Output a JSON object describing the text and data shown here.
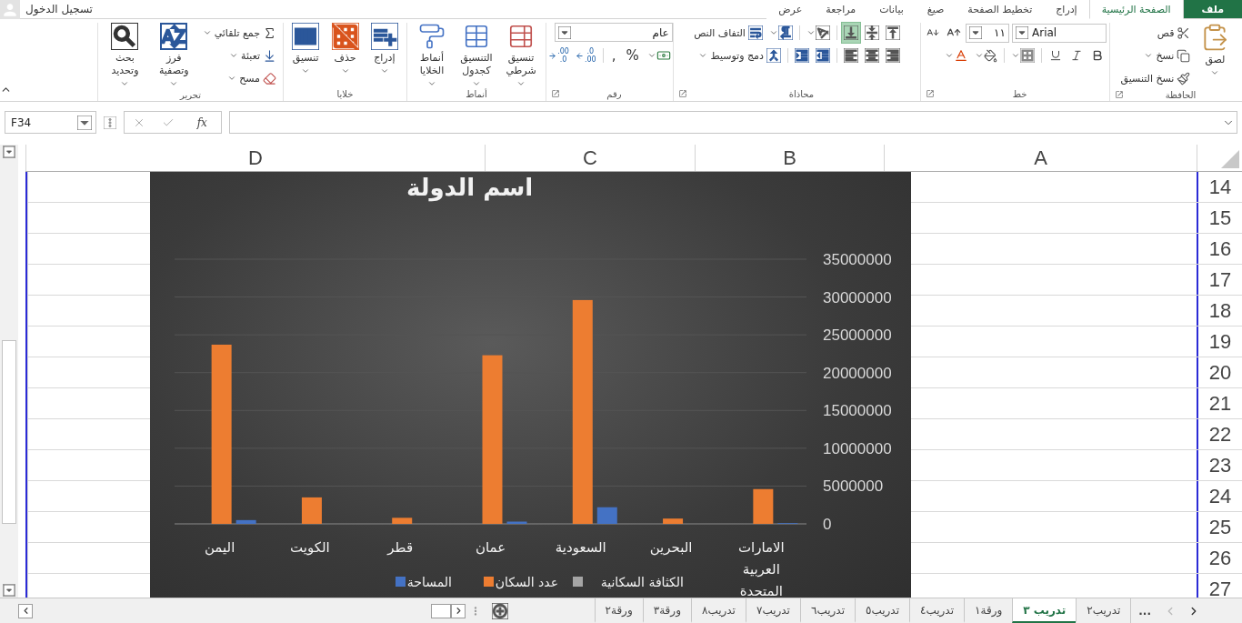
{
  "file_button": {
    "label": "ملف"
  },
  "menu_tabs": [
    {
      "label": "الصفحة الرئيسية",
      "kind": "tab",
      "selected": true
    },
    {
      "label": "إدراج",
      "kind": "tab",
      "selected": false
    },
    {
      "label": "تخطيط الصفحة",
      "kind": "tab",
      "selected": false
    },
    {
      "label": "صيغ",
      "kind": "tab",
      "selected": false
    },
    {
      "label": "بيانات",
      "kind": "tab",
      "selected": false
    },
    {
      "label": "مراجعة",
      "kind": "tab",
      "selected": false
    },
    {
      "label": "عرض",
      "kind": "tab",
      "selected": false
    }
  ],
  "account": {
    "label": "تسجيل الدخول"
  },
  "ribbon": {
    "groups": [
      {
        "kind": "clipboard",
        "name": "الحافظة",
        "launcher": true,
        "paste": {
          "label": "لصق"
        },
        "actions": [
          {
            "label": "قص",
            "dropdown": false
          },
          {
            "label": "نسخ",
            "dropdown": true
          },
          {
            "label": "نسخ التنسيق",
            "dropdown": false
          }
        ]
      },
      {
        "kind": "font",
        "name": "خط",
        "launcher": true,
        "font_name": "Arial",
        "font_size": "١١"
      },
      {
        "kind": "alignment",
        "name": "محاذاة",
        "launcher": true,
        "vertical_align": [
          {
            "selected": false
          },
          {
            "selected": false
          },
          {
            "selected": true
          }
        ],
        "wrap_text": {
          "label": "التفاف النص"
        },
        "merge": {
          "label": "دمج وتوسيط"
        }
      },
      {
        "kind": "number",
        "name": "رقم",
        "launcher": true,
        "format": "عام",
        "symbols": [
          "%",
          ","
        ],
        "decimals": [
          {
            "top": ".0",
            "bottom": ".00"
          },
          {
            "top": ".00",
            "bottom": ".0"
          }
        ]
      },
      {
        "kind": "large_buttons",
        "name": "أنماط",
        "buttons": [
          {
            "label": "تنسيق شرطي"
          },
          {
            "label": "التنسيق كجدول"
          },
          {
            "label": "أنماط الخلايا"
          }
        ]
      },
      {
        "kind": "large_buttons",
        "name": "خلايا",
        "buttons": [
          {
            "label": "إدراج"
          },
          {
            "label": "حذف"
          },
          {
            "label": "تنسيق"
          }
        ]
      },
      {
        "kind": "editing",
        "name": "تحرير",
        "actions": [
          {
            "label": "جمع تلقائي"
          },
          {
            "label": "تعبئة"
          },
          {
            "label": "مسح"
          }
        ],
        "buttons": [
          {
            "label": "فرز وتصفية"
          },
          {
            "label": "بحث وتحديد"
          }
        ]
      }
    ]
  },
  "formula_bar": {
    "name_box": "F34",
    "fx": "fx"
  },
  "sheet": {
    "columns": [
      "A",
      "B",
      "C",
      "D"
    ],
    "rows": [
      "14",
      "15",
      "16",
      "17",
      "18",
      "19",
      "20",
      "21",
      "22",
      "23",
      "24",
      "25",
      "26",
      "27"
    ],
    "chart": {
      "chart_data": {
        "type": "bar",
        "title": "اسم الدولة",
        "categories": [
          "اليمن",
          "الكويت",
          "قطر",
          "عمان",
          "السعودية",
          "البحرين",
          "الامارات العربية المتحدة"
        ],
        "series": [
          {
            "name": "الكثافة السكانية",
            "color": "#a5a5a5",
            "values": [
              0,
              0,
              0,
              0,
              0,
              0,
              0
            ]
          },
          {
            "name": "عدد السكان",
            "color": "#ed7d31",
            "values": [
              23700000,
              3500000,
              800000,
              22300000,
              29600000,
              700000,
              4600000
            ]
          },
          {
            "name": "المساحة",
            "color": "#4472c4",
            "values": [
              500000,
              0,
              0,
              300000,
              2200000,
              0,
              100000
            ]
          }
        ],
        "grid": true,
        "legend": true,
        "ylim": [
          0,
          35000000
        ],
        "yticks": [
          0,
          5000000,
          10000000,
          15000000,
          20000000,
          25000000,
          30000000,
          35000000
        ]
      }
    }
  },
  "sheet_tabs": {
    "more": "...",
    "tabs": [
      {
        "label": "تدريب٢",
        "selected": false
      },
      {
        "label": "تدريب ٣",
        "selected": true
      },
      {
        "label": "ورقة١",
        "selected": false
      },
      {
        "label": "تدريب٤",
        "selected": false
      },
      {
        "label": "تدريب٥",
        "selected": false
      },
      {
        "label": "تدريب٦",
        "selected": false
      },
      {
        "label": "تدريب٧",
        "selected": false
      },
      {
        "label": "تدريب٨",
        "selected": false
      },
      {
        "label": "ورقة٣",
        "selected": false
      },
      {
        "label": "ورقة٢",
        "selected": false
      }
    ]
  }
}
